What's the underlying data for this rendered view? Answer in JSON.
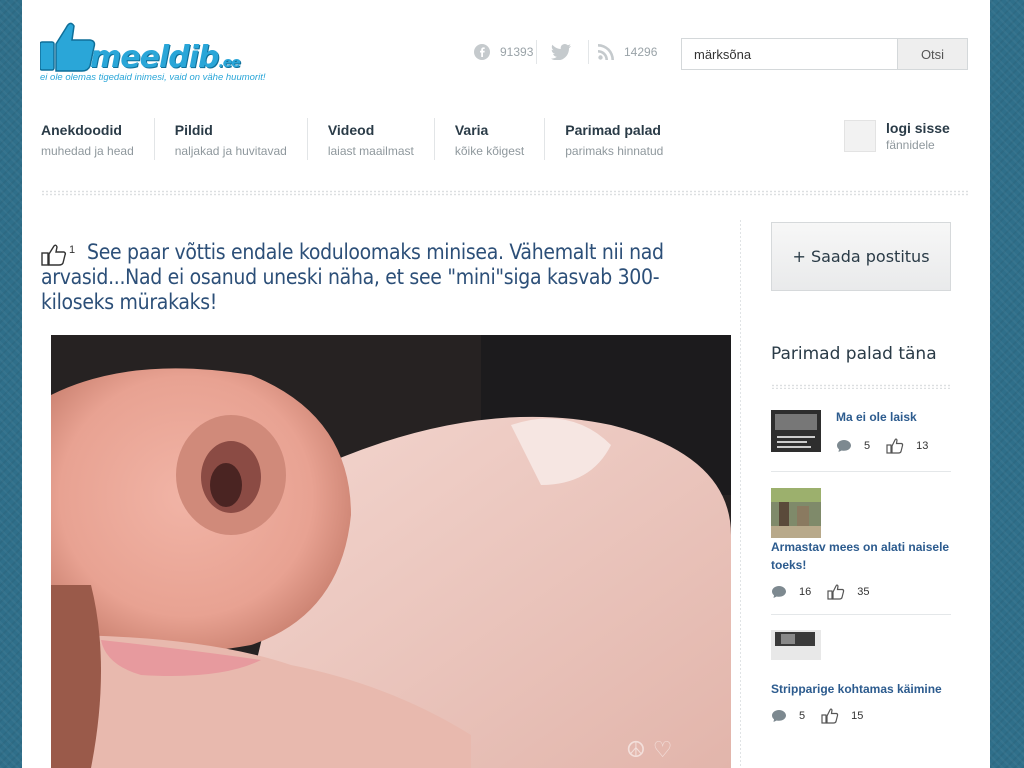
{
  "site": {
    "logo_word": "meeldib",
    "logo_tld": ".ee",
    "tagline": "ei ole olemas tigedaid inimesi, vaid on vähe huumorit!"
  },
  "social": {
    "facebook_count": "91393",
    "rss_count": "14296"
  },
  "search": {
    "value": "märksõna",
    "button_label": "Otsi"
  },
  "nav": [
    {
      "title": "Anekdoodid",
      "subtitle": "muhedad ja head"
    },
    {
      "title": "Pildid",
      "subtitle": "naljakad ja huvitavad"
    },
    {
      "title": "Videod",
      "subtitle": "laiast maailmast"
    },
    {
      "title": "Varia",
      "subtitle": "kõike kõigest"
    },
    {
      "title": "Parimad palad",
      "subtitle": "parimaks hinnatud"
    }
  ],
  "login": {
    "title": "logi sisse",
    "subtitle": "fännidele"
  },
  "post": {
    "like_count": "1",
    "title": "See paar võttis endale koduloomaks minisea. Vähemalt nii nad arvasid...Nad ei osanud uneski näha, et see \"mini\"siga kasvab 300-kiloseks mürakaks!"
  },
  "sidebar": {
    "send_button": "+ Saada postitus",
    "best_title": "Parimad palad täna",
    "items": [
      {
        "title": "Ma ei ole laisk",
        "comments": "5",
        "likes": "13"
      },
      {
        "title": "Armastav mees on alati naisele toeks!",
        "comments": "16",
        "likes": "35"
      },
      {
        "title": "Stripparige kohtamas käimine",
        "comments": "5",
        "likes": "15"
      }
    ]
  },
  "colors": {
    "background": "#2f6f8a",
    "brand": "#2aa6d8",
    "title_blue": "#2c4f78",
    "link_blue": "#2c5b8e"
  }
}
